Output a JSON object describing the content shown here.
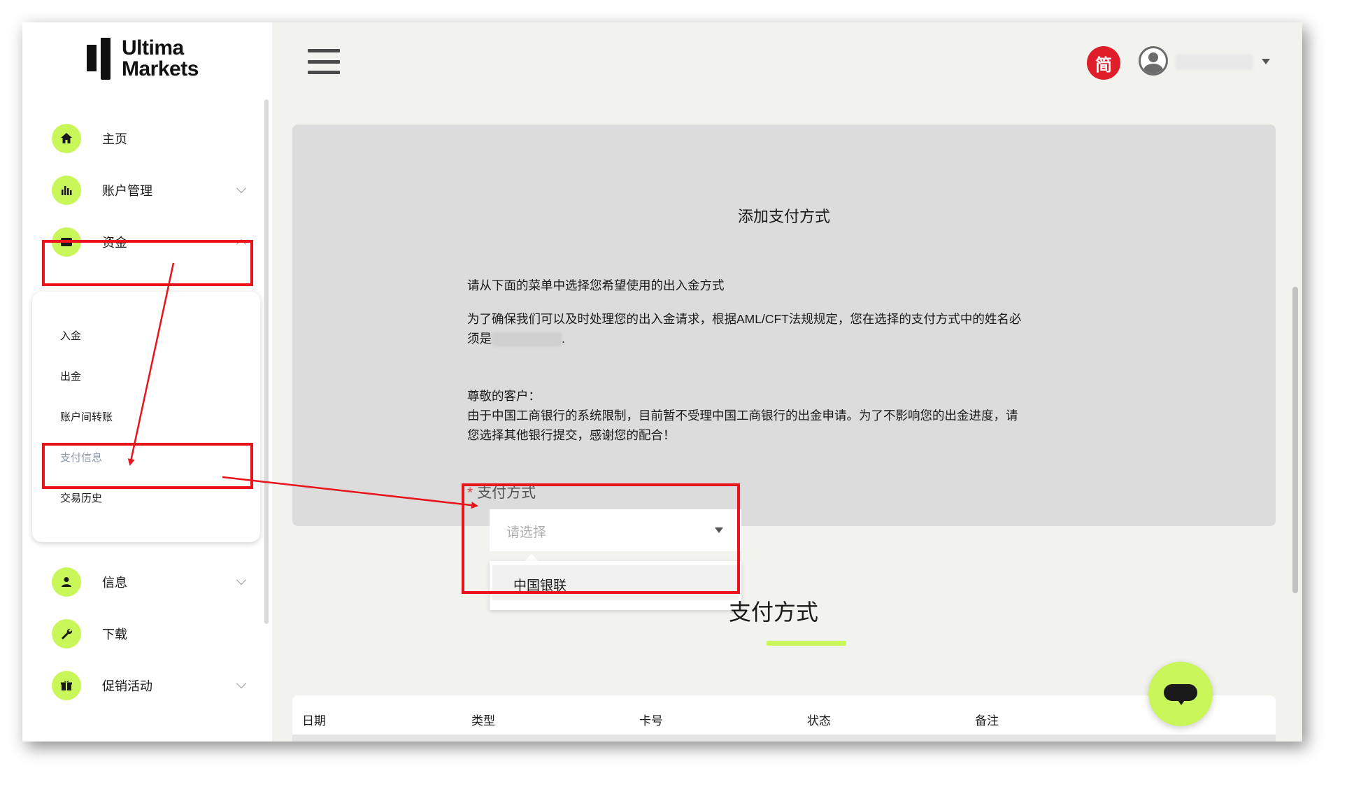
{
  "brand": {
    "line1": "Ultima",
    "line2": "Markets"
  },
  "sidebar": {
    "items": [
      {
        "label": "主页",
        "icon": "home-icon"
      },
      {
        "label": "账户管理",
        "icon": "bar-chart-icon"
      },
      {
        "label": "资金",
        "icon": "credit-card-icon"
      },
      {
        "label": "信息",
        "icon": "user-icon"
      },
      {
        "label": "下载",
        "icon": "wrench-icon"
      },
      {
        "label": "促销活动",
        "icon": "gift-icon"
      }
    ],
    "funds_submenu": [
      "入金",
      "出金",
      "账户间转账",
      "支付信息",
      "交易历史"
    ]
  },
  "header": {
    "language_badge": "简"
  },
  "card": {
    "title": "添加支付方式",
    "para1": "请从下面的菜单中选择您希望使用的出入金方式",
    "para2_line1": "为了确保我们可以及时处理您的出入金请求，根据AML/CFT法规规定，您在选择的支付方式中的姓名必",
    "para2_line2_prefix": "须是",
    "para2_line2_suffix": ".",
    "notice_heading": "尊敬的客户：",
    "notice_line1": "由于中国工商银行的系统限制，目前暂不受理中国工商银行的出金申请。为了不影响您的出金进度，请",
    "notice_line2": "您选择其他银行提交，感谢您的配合！",
    "field_required_mark": "*",
    "field_label": "支付方式",
    "select_placeholder": "请选择",
    "dropdown_options": [
      "中国银联"
    ]
  },
  "section": {
    "title": "支付方式"
  },
  "table": {
    "headers": [
      "日期",
      "类型",
      "卡号",
      "状态",
      "备注"
    ]
  },
  "colors": {
    "accent": "#c9f75a",
    "annotation_red": "#e8141c",
    "lang_badge": "#e01e2a"
  }
}
